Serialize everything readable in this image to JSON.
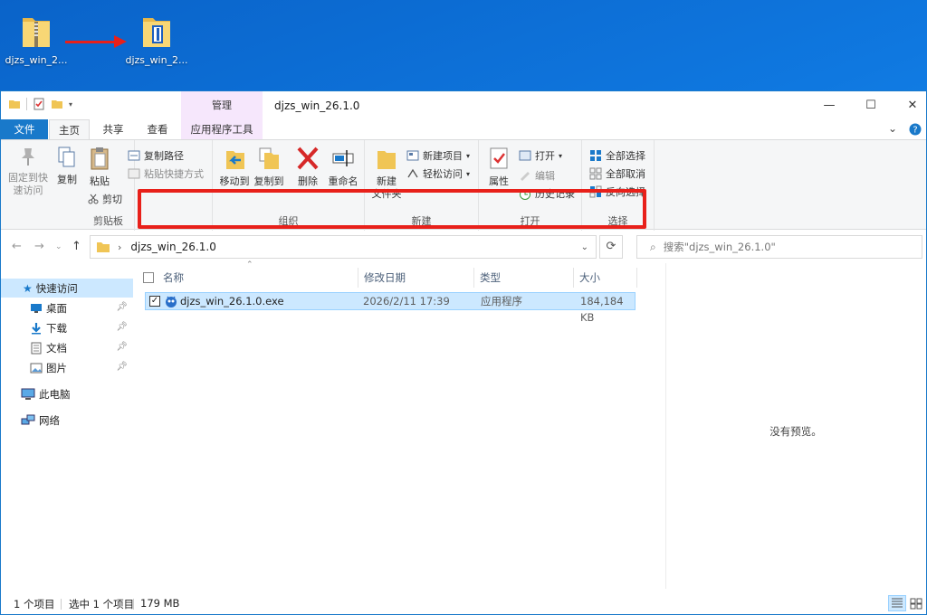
{
  "desktop": {
    "icons": [
      {
        "label": "djzs_win_2...",
        "icon": "zip-folder-icon"
      },
      {
        "label": "djzs_win_2...",
        "icon": "folder-icon"
      }
    ],
    "arrow_color": "#e8201a"
  },
  "window": {
    "title": "djzs_win_26.1.0",
    "context_tab": "管理",
    "controls": {
      "minimize": "—",
      "maximize": "☐",
      "close": "✕"
    }
  },
  "tabs": {
    "file": "文件",
    "home": "主页",
    "share": "共享",
    "view": "查看",
    "app_tools": "应用程序工具"
  },
  "ribbon": {
    "clipboard": {
      "name": "剪贴板",
      "pin": "固定到快\n速访问",
      "copy": "复制",
      "paste": "粘贴",
      "copy_path": "复制路径",
      "paste_shortcut": "粘贴快捷方式",
      "cut": "剪切"
    },
    "organize": {
      "name": "组织",
      "move_to": "移动到",
      "copy_to": "复制到",
      "delete": "删除",
      "rename": "重命名"
    },
    "new": {
      "name": "新建",
      "new_folder": "新建\n文件夹",
      "new_item": "新建项目",
      "easy_access": "轻松访问"
    },
    "open": {
      "name": "打开",
      "properties": "属性",
      "open": "打开",
      "edit": "编辑",
      "history": "历史记录"
    },
    "select": {
      "name": "选择",
      "select_all": "全部选择",
      "select_none": "全部取消",
      "invert": "反向选择"
    }
  },
  "address": {
    "crumb": "djzs_win_26.1.0",
    "search_placeholder": "搜索\"djzs_win_26.1.0\""
  },
  "navpane": {
    "quick_access": "快速访问",
    "items": [
      {
        "label": "桌面",
        "icon": "desktop-icon"
      },
      {
        "label": "下载",
        "icon": "download-icon"
      },
      {
        "label": "文档",
        "icon": "document-icon"
      },
      {
        "label": "图片",
        "icon": "picture-icon"
      }
    ],
    "this_pc": "此电脑",
    "network": "网络"
  },
  "columns": {
    "name": "名称",
    "modified": "修改日期",
    "type": "类型",
    "size": "大小"
  },
  "files": [
    {
      "name": "djzs_win_26.1.0.exe",
      "modified": "2026/2/11 17:39",
      "type": "应用程序",
      "size": "184,184 KB",
      "checked": true
    }
  ],
  "highlight_color": "#e8201a",
  "preview": {
    "message": "没有预览。"
  },
  "status": {
    "count": "1 个项目",
    "selected": "选中 1 个项目",
    "size": "179 MB"
  }
}
